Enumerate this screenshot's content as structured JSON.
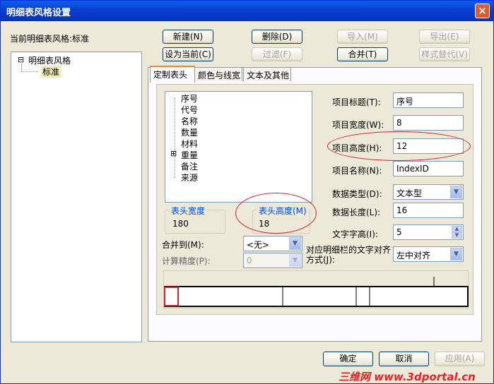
{
  "window": {
    "title": "明细表风格设置",
    "close_glyph": "×"
  },
  "current_style": {
    "label": "当前明细表风格:",
    "value": "标准"
  },
  "buttons": {
    "new": "新建(N)",
    "delete": "删除(D)",
    "import": "导入(M)",
    "export": "导出(E)",
    "set_current": "设为当前(C)",
    "filter": "过滤(F)",
    "merge": "合并(T)",
    "replace": "样式替代(V)",
    "ok": "确定",
    "cancel": "取消",
    "apply": "应用(A)"
  },
  "tree": {
    "root": "明细表风格",
    "child": "标准",
    "expander": "⊟"
  },
  "tabs": [
    "定制表头",
    "颜色与线宽",
    "文本及其他"
  ],
  "columns": [
    "序号",
    "代号",
    "名称",
    "数量",
    "材料",
    "重量",
    "备注",
    "来源"
  ],
  "header_width": {
    "label": "表头宽度",
    "value": "180"
  },
  "header_height": {
    "label": "表头高度(M)",
    "value": "18"
  },
  "merge_to": {
    "label": "合并到(M):",
    "value": "<无>"
  },
  "precision": {
    "label": "计算精度(P):",
    "value": "0"
  },
  "props": {
    "title": {
      "label": "项目标题(T):",
      "value": "序号"
    },
    "width": {
      "label": "项目宽度(W):",
      "value": "8"
    },
    "height": {
      "label": "项目高度(H):",
      "value": "12"
    },
    "name": {
      "label": "项目名称(N):",
      "value": "IndexID"
    },
    "dtype": {
      "label": "数据类型(D):",
      "value": "文本型"
    },
    "dlen": {
      "label": "数据长度(L):",
      "value": "16"
    },
    "fsize": {
      "label": "文字字高(I):",
      "value": "5"
    },
    "align": {
      "label": "对应明细栏的文字对齐方式(J):",
      "value": "左中对齐"
    }
  },
  "watermark": "三维网 www.3dportal.cn",
  "colors": {
    "accent": "#e68b2c",
    "title_bar": "#0a5fe6",
    "annotation": "#d8202a"
  }
}
